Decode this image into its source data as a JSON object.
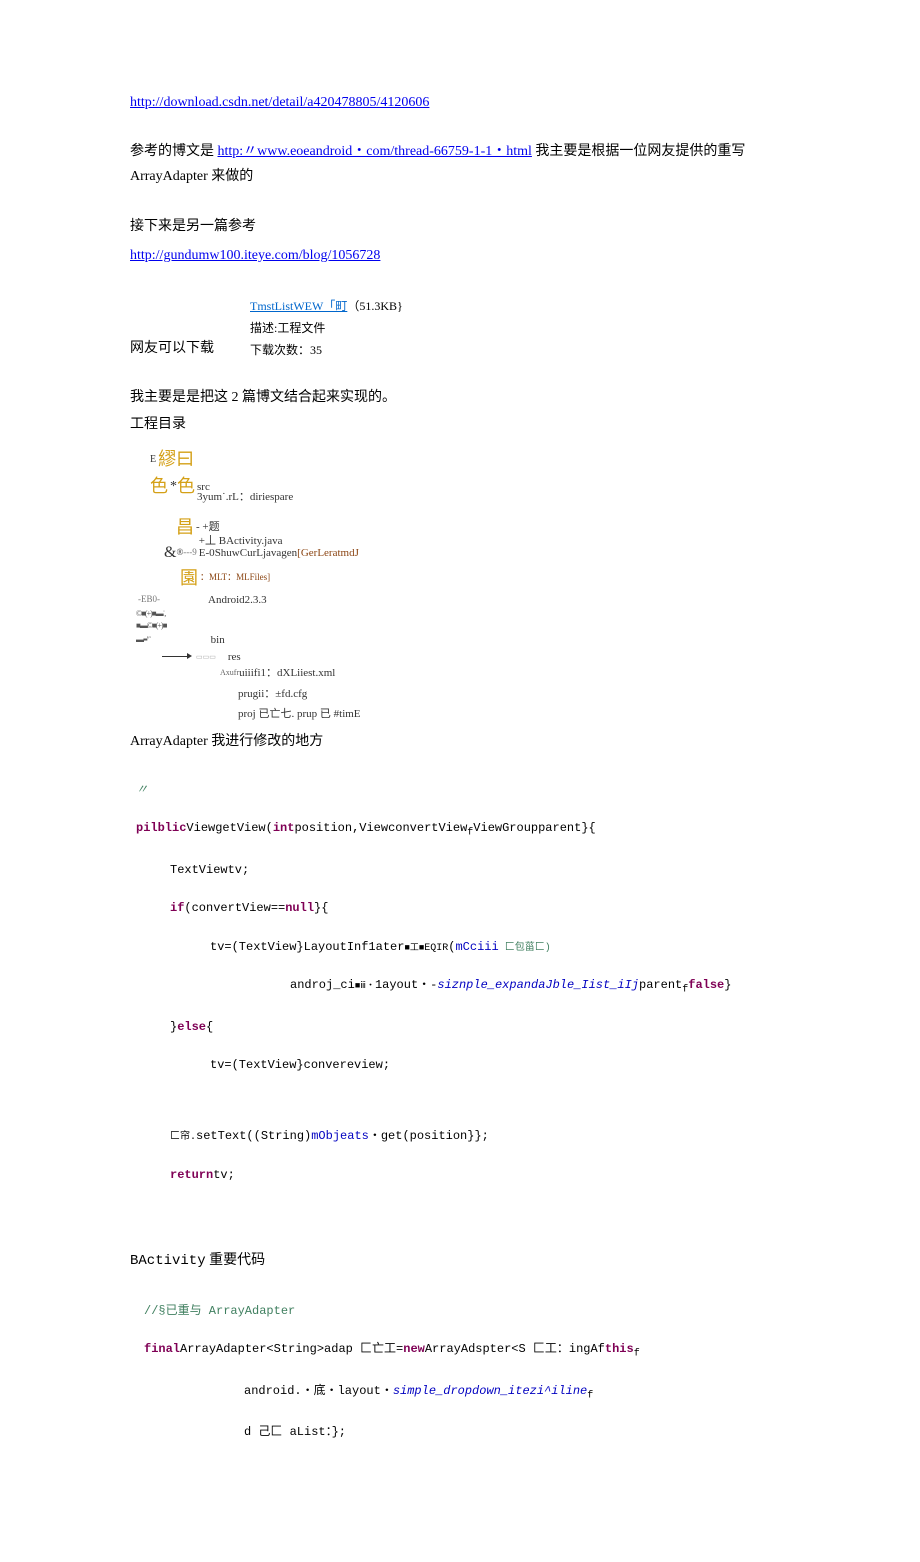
{
  "links": {
    "link1": "http://download.csdn.net/detail/a420478805/4120606",
    "link2_prefix": "参考的博文是 ",
    "link2": "http:〃www.eoeandroid・com/thread-66759-1-1・html",
    "link2_suffix": " 我主要是根据一位网友提供的重写 ArrayAdapter 来做的",
    "link3_intro": "接下来是另一篇参考",
    "link3": "http://gundumw100.iteye.com/blog/1056728"
  },
  "attachment": {
    "name": "TmstListWEW「町",
    "size_prefix": "（",
    "size": "51.3KB}",
    "desc_label": "描述:",
    "desc_value": "工程文件",
    "count_label": "下载次数：",
    "count_value": "35"
  },
  "text": {
    "download_note": "网友可以下载",
    "combine_note": "我主要是是把这 2 篇博文结合起来实现的。",
    "dir_label": "工程目录"
  },
  "tree": {
    "g1": "E",
    "g1b": "繆曰",
    "g2a": "色",
    "g2b": "*",
    "g2c": "色",
    "g2_label": "src",
    "g2_sub": "3yum˙.rL：diriespare",
    "g3": "昌",
    "g3_label": "- +题",
    "g4a": "&",
    "g4b": "®",
    "g4c": "---9",
    "g4_label1": "+丄 BActivity.java",
    "g4_label2": "E-0",
    "g4_label2b": "ShuwCurLjavagen",
    "g4_label2c": "[GerLeratmdJ",
    "g5": "園",
    "g5_label": "：MLT：MLFiles]",
    "g6a": "-EB0-",
    "g6_label": "Android2.3.3",
    "g7a": "©■(+)■▬˙,",
    "g7b": "■▬©■(+)■",
    "g7c": "▬▪▪″˙",
    "g8_label": "bin",
    "g9_label": "res",
    "g10": "Axufr",
    "g10_label": "uiiifi1：dXLiiest.xml",
    "g11_label": "prugii：±fd.cfg",
    "g12_label": "proj 已亡七. prup 已 #timE"
  },
  "code_header": "ArrayAdapter 我进行修改的地方",
  "code1": {
    "l0": "〃",
    "l1_a": "pilblic",
    "l1_b": "ViewgetView(",
    "l1_c": "int",
    "l1_d": "position,ViewconvertView",
    "l1_e": "f",
    "l1_f": "ViewGroupparent}{",
    "l2": "TextViewtv;",
    "l3_a": "if",
    "l3_b": "(convertView==",
    "l3_c": "null",
    "l3_d": "}{",
    "l4_a": "tv=(TextView}LayoutInf1ater",
    "l4_b": "■工■",
    "l4_c": "EQIR",
    "l4_d": "(",
    "l4_e": "mCciii",
    "l4_f": " 匚包菑匚)",
    "l5_a": "androj_ci",
    "l5_b": "■ⅲ・",
    "l5_c": "1ayout・-",
    "l5_d": "siznple_expandaJble_Iist_iIj",
    "l5_e": "parent",
    "l5_f": "f",
    "l5_g": "false",
    "l5_h": "}",
    "l6_a": "}",
    "l6_b": "else",
    "l6_c": "{",
    "l7": "tv=(TextView}convereview;",
    "l8_a": "匚帘.",
    "l8_b": "setText((String)",
    "l8_c": "mObjeats",
    "l8_d": "・get(position}};",
    "l9_a": "return",
    "l9_b": "tv;"
  },
  "code2_header": "BActivity",
  "code2_header_suffix": " 重要代码",
  "code2": {
    "l1": "//§已重与 ArrayAdapter",
    "l2_a": "final",
    "l2_b": "ArrayAdapter<String>adap 匚亡工=",
    "l2_c": "new",
    "l2_d": "ArrayAdspter<S 匚工：ingAf",
    "l2_e": "this",
    "l2_f": "f",
    "l3_a": "android.・底・layout・",
    "l3_b": "simple_dropdown_itezi^iline",
    "l3_c": "f",
    "l4": "d 己匚 aList：};"
  }
}
